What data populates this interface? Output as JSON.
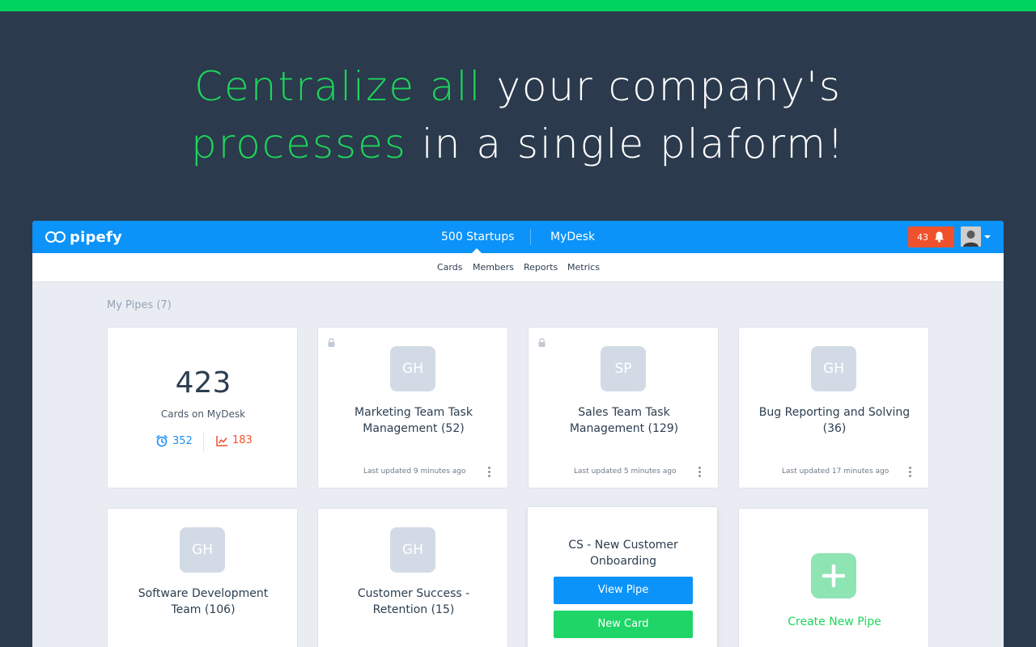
{
  "headline": {
    "line1_accent": "Centralize all",
    "line1_rest": "your company's",
    "line2_accent": "processes",
    "line2_rest": "in a single plaform!"
  },
  "app": {
    "logo_text": "pipefy",
    "orgs": [
      "500 Startups",
      "MyDesk"
    ],
    "notification_count": "43",
    "subnav": [
      "Cards",
      "Members",
      "Reports",
      "Metrics"
    ],
    "section_title": "My Pipes (7)",
    "mydesk_card": {
      "count": "423",
      "label": "Cards on MyDesk",
      "late_count": "352",
      "trend_count": "183"
    },
    "pipes": [
      {
        "initials": "GH",
        "title": "Marketing Team Task Management (52)",
        "updated": "Last updated 9 minutes ago",
        "locked": true
      },
      {
        "initials": "SP",
        "title": "Sales Team Task Management  (129)",
        "updated": "Last updated 5 minutes ago",
        "locked": true
      },
      {
        "initials": "GH",
        "title": "Bug Reporting and Solving (36)",
        "updated": "Last updated 17 minutes ago",
        "locked": false
      },
      {
        "initials": "GH",
        "title": "Software Development Team (106)"
      },
      {
        "initials": "GH",
        "title": "Customer Success - Retention (15)"
      }
    ],
    "hover_card": {
      "title": "CS - New Customer Onboarding",
      "view_button": "View Pipe",
      "new_card_button": "New Card"
    },
    "create_pipe_label": "Create New Pipe"
  },
  "colors": {
    "background": "#2b3a4d",
    "accent_green": "#1dd65a",
    "header_blue": "#0b93f9",
    "notification_red": "#f0512d"
  }
}
